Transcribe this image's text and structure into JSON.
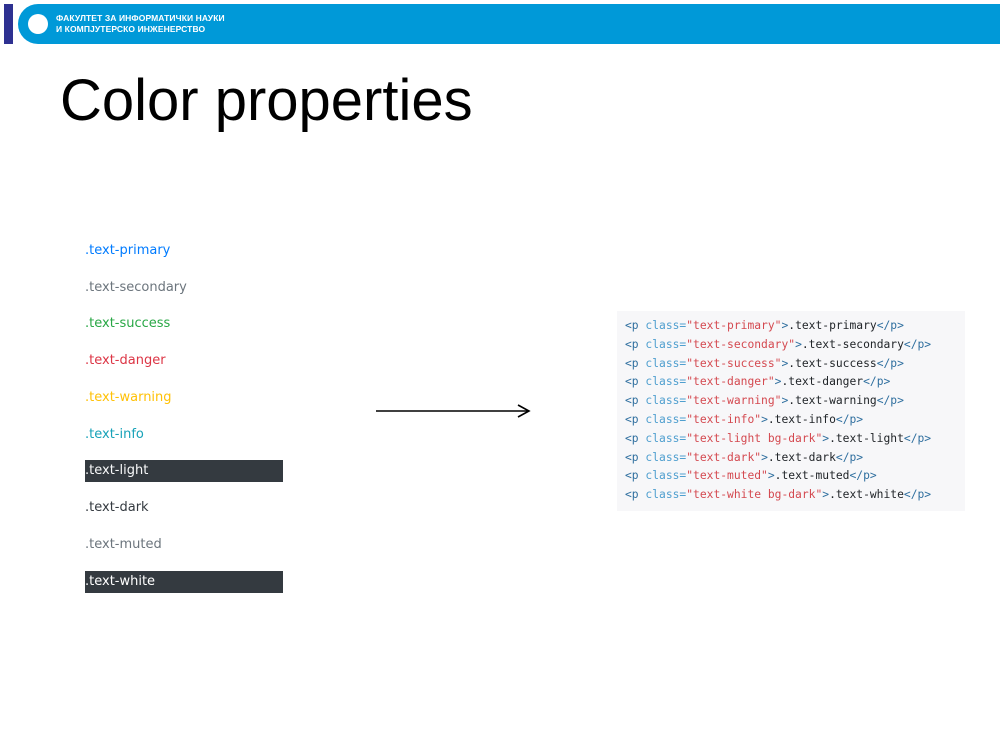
{
  "header": {
    "line1": "ФАКУЛТЕТ ЗА ИНФОРМАТИЧКИ НАУКИ",
    "line2": "И КОМПЈУТЕРСКО ИНЖЕНЕРСТВО"
  },
  "slide": {
    "title": "Color properties"
  },
  "demo_items": [
    {
      "text": ".text-primary",
      "color": "#007bff",
      "bg": ""
    },
    {
      "text": ".text-secondary",
      "color": "#6c757d",
      "bg": ""
    },
    {
      "text": ".text-success",
      "color": "#28a745",
      "bg": ""
    },
    {
      "text": ".text-danger",
      "color": "#dc3545",
      "bg": ""
    },
    {
      "text": ".text-warning",
      "color": "#ffc107",
      "bg": ""
    },
    {
      "text": ".text-info",
      "color": "#17a2b8",
      "bg": ""
    },
    {
      "text": ".text-light",
      "color": "#f8f9fa",
      "bg": "#343a40"
    },
    {
      "text": ".text-dark",
      "color": "#343a40",
      "bg": ""
    },
    {
      "text": ".text-muted",
      "color": "#6c757d",
      "bg": ""
    },
    {
      "text": ".text-white",
      "color": "#ffffff",
      "bg": "#343a40"
    }
  ],
  "code": {
    "tag_open": "<p",
    "attr": "class=",
    "tag_close": "</p>",
    "lines": [
      {
        "class_value": "\"text-primary\"",
        "content": ".text-primary"
      },
      {
        "class_value": "\"text-secondary\"",
        "content": ".text-secondary"
      },
      {
        "class_value": "\"text-success\"",
        "content": ".text-success"
      },
      {
        "class_value": "\"text-danger\"",
        "content": ".text-danger"
      },
      {
        "class_value": "\"text-warning\"",
        "content": ".text-warning"
      },
      {
        "class_value": "\"text-info\"",
        "content": ".text-info"
      },
      {
        "class_value": "\"text-light bg-dark\"",
        "content": ".text-light"
      },
      {
        "class_value": "\"text-dark\"",
        "content": ".text-dark"
      },
      {
        "class_value": "\"text-muted\"",
        "content": ".text-muted"
      },
      {
        "class_value": "\"text-white bg-dark\"",
        "content": ".text-white"
      }
    ]
  }
}
